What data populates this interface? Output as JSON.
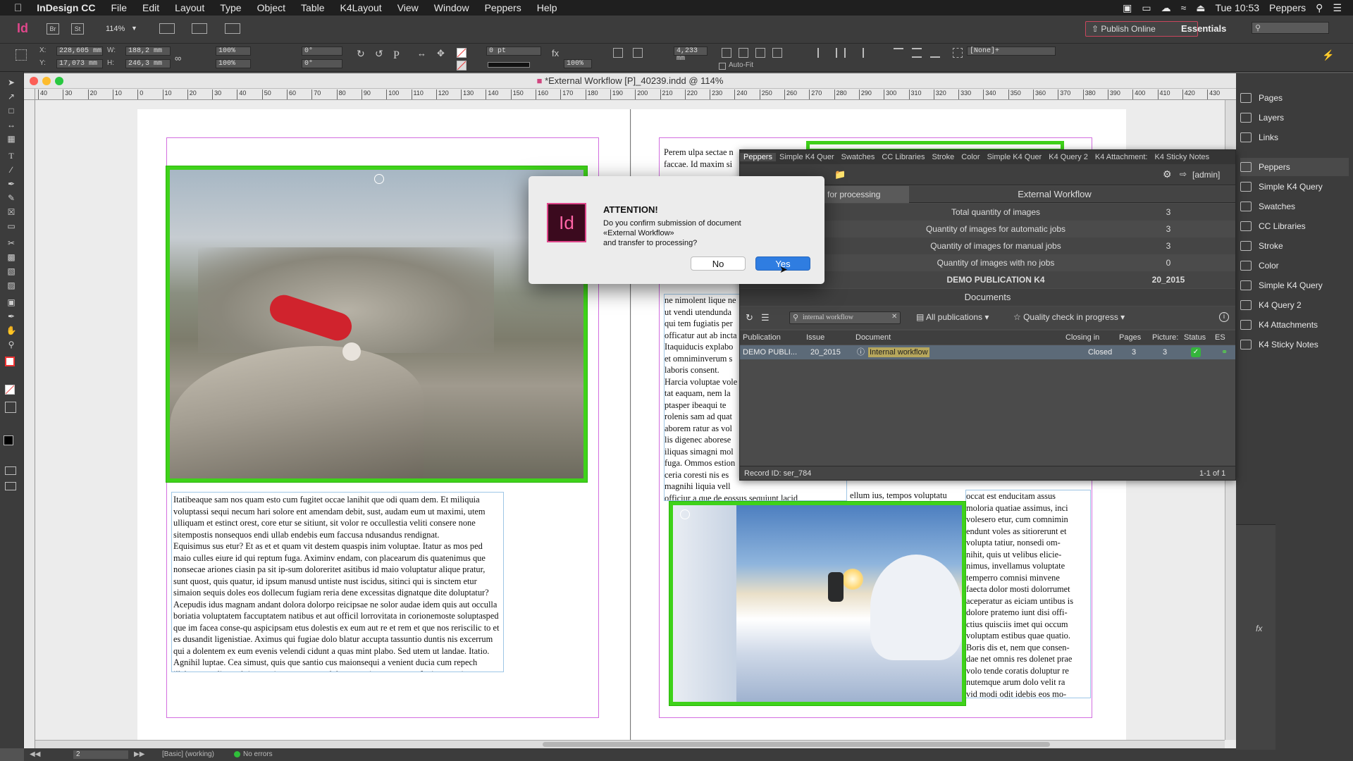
{
  "menubar": {
    "app_name": "InDesign CC",
    "items": [
      "File",
      "Edit",
      "Layout",
      "Type",
      "Object",
      "Table",
      "K4Layout",
      "View",
      "Window",
      "Peppers",
      "Help"
    ],
    "clock": "Tue 10:53",
    "user": "Peppers"
  },
  "appbar": {
    "zoom": "114%",
    "publish_label": "Publish Online",
    "workspace": "Essentials"
  },
  "control": {
    "x": "228,605 mm",
    "y": "17,073 mm",
    "w": "188,2 mm",
    "h": "246,3 mm",
    "scale_x": "100%",
    "scale_y": "100%",
    "angle": "0°",
    "shear": "0°",
    "stroke_weight": "0 pt",
    "opacity": "100%",
    "offset": "4,233 mm",
    "auto_fit": "Auto-Fit",
    "style": "[None]+"
  },
  "document": {
    "title": "*External Workflow [P]_40239.indd @ 114%",
    "ruler_marks": [
      "40",
      "30",
      "20",
      "10",
      "0",
      "10",
      "20",
      "30",
      "40",
      "50",
      "60",
      "70",
      "80",
      "90",
      "100",
      "110",
      "120",
      "130",
      "140",
      "150",
      "160",
      "170",
      "180",
      "190",
      "200",
      "210",
      "220",
      "230",
      "240",
      "250",
      "260",
      "270",
      "280",
      "290",
      "300",
      "310",
      "320",
      "330",
      "340",
      "350",
      "360",
      "370",
      "380",
      "390",
      "400",
      "410",
      "420",
      "430"
    ],
    "left_text": "Itatibeaque sam nos quam esto cum fugitet occae lanihit que odi quam dem. Et miliquia voluptassi sequi necum hari solore ent amendam debit, sust, audam eum ut maximi, utem ulliquam et estinct orest, core etur se sitiunt, sit volor re occullestia veliti consere none sitempostis nonsequos endi ullab endebis eum faccusa ndusandus rendignat.\nEquisimus sus etur? Et as et et quam vit destem quaspis inim voluptae. Itatur as mos ped maio culles eiure id qui reptum fuga. Aximinv endam, con placearum dis quatenimus que nonsecae ariones ciasin pa sit ip-sum doloreritet asitibus id maio voluptatur alique pratur, sunt quost, quis quatur, id ipsum manusd untiste nust iscidus, sitinci qui is sinctem etur simaion sequis doles eos dollecum fugiam reria dene excessitas dignatque dite doluptatur?\nAcepudis idus magnam andant dolora dolorpo reicipsae ne solor audae idem quis aut occulla boriatia voluptatem faccuptatem natibus et aut officil lorrovitata in corionemoste soluptasped que im facea conse-qu aspicipsam etus dolestis ex eum aut re et rem et que nos reriscilic to et es dusandit ligenistiae. Aximus qui fugiae dolo blatur accupta tassuntio duntis nis excerrum qui a dolentem ex eum evenis velendi cidunt a quas mint plabo. Sed utem ut landae. Itatio. Agnihil luptae. Cea simust, quis que santio cus maionsequi a venient ducia cum repech illabor expuditent ab inctor sinctusam sa pa dolorem essimagnatur aut fugiatur senima nem que id moluptio volupta por secabo. Nam abo. Itatur?\nAligendandi diam, cum quis et ratqui berum nos doluptur sincilictas amustotatemo doluptis eostrum ut venes re vella dolestem est liquodi tenetur?\nComni totati nate voles apereris sitatur eprovidestis eliaspidisti omnihilla deriatquam que volendio. Buscit",
    "right_top_lines": [
      "Perem ulpa sectae n",
      "faccae. Id maxim si"
    ],
    "right_mid_text": "ne nimolent lique ne\nut vendi utendunda\nqui tem fugiatis per\nofficatur aut ab incta\nItaquiducis explabo\net omniminverum s\nlaboris consent.\nHarcia voluptae vole\ntat eaquam, nem la\nptasper ibeaqui te\nrolenis sam ad quat\naborem ratur as vol\nlis digenec aborese\niliquas simagni mol\nfuga. Ommos estion\nceria coresti nis es\nmagnihi liquia vell\nofficiur a que de eossus sequiunt lacid",
    "right_col_text": "occat est enducitam assus\nmoloria quatiae assimus, inci\nvolesero etur, cum comnimin\nendunt voles as sitiorerunt et\nvolupta tatiur, nonsedi om-\nnihit, quis ut velibus elicie-\nnimus, invellamus voluptate\ntemperro comnisi minvene\nfaecta dolor mosti dolorrumet\naceperatur as eiciam untibus is\ndolore pratemo iunt disi offi-\nctius quisciis imet qui occum\nvoluptam estibus quae quatio.\nBoris dis et, nem que consen-\ndae net omnis res dolenet prae\nvolo tende coratis doluptur re\nnutemque arum dolo velit ra\nvid modi odit idebis eos mo-\nluptiaerum qui dolores",
    "mid_col_text": "ellum ius, tempos voluptatu"
  },
  "peppers_panel": {
    "tabs": [
      "Peppers",
      "Simple K4 Quer",
      "Swatches",
      "CC Libraries",
      "Stroke",
      "Color",
      "Simple K4 Quer",
      "K4 Query 2",
      "K4 Attachment:",
      "K4 Sticky Notes"
    ],
    "user": "[admin]",
    "tab_left": "for processing",
    "section_title": "External Workflow",
    "stats": [
      {
        "label": "Total quantity of images",
        "value": "3"
      },
      {
        "label": "Quantity of images for automatic jobs",
        "value": "3"
      },
      {
        "label": "Quantity of images for manual jobs",
        "value": "3"
      },
      {
        "label": "Quantity of images with no jobs",
        "value": "0"
      }
    ],
    "pub_row": {
      "label": "DEMO PUBLICATION K4",
      "value": "20_2015"
    },
    "documents_title": "Documents",
    "search_value": "internal workflow",
    "publications_filter": "All publications",
    "status_filter": "Quality check in progress",
    "columns": [
      "Publication",
      "Issue",
      "Document",
      "Closing in",
      "Pages",
      "Picture:",
      "Status",
      "ES"
    ],
    "rows": [
      {
        "publication": "DEMO PUBLI...",
        "issue": "20_2015",
        "document": "Internal workflow",
        "closing": "Closed",
        "pages": "3",
        "pictures": "3"
      }
    ],
    "record_id": "Record ID: ser_784",
    "pagination": "1-1 of 1"
  },
  "dialog": {
    "title": "ATTENTION!",
    "message_1": "Do you confirm submission of document",
    "message_2": "«External Workflow»",
    "message_3": "and transfer to processing?",
    "no_label": "No",
    "yes_label": "Yes",
    "app_icon_text": "Id"
  },
  "right_dock": {
    "group1": [
      "Pages",
      "Layers",
      "Links"
    ],
    "group2": [
      "Peppers",
      "Simple K4 Query",
      "Swatches",
      "CC Libraries",
      "Stroke",
      "Color",
      "Simple K4 Query",
      "K4 Query  2",
      "K4 Attachments",
      "K4 Sticky Notes"
    ]
  },
  "statusbar": {
    "page": "2",
    "preflight_profile": "[Basic] (working)",
    "errors": "No errors"
  },
  "colors": {
    "frame_green": "#3fd21a",
    "accent_blue": "#2f7de1",
    "peppers_bg": "#4b4b4b"
  }
}
